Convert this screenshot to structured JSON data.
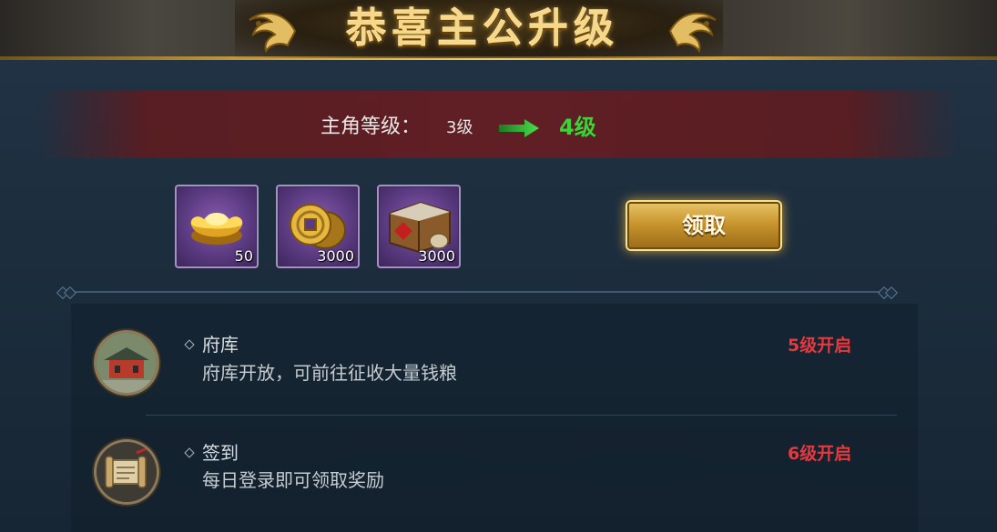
{
  "header": {
    "title": "恭喜主公升级",
    "left_ornament": "dragon-ornament-icon",
    "right_ornament": "dragon-ornament-icon"
  },
  "level": {
    "label": "主角等级：",
    "from": "3级",
    "to": "4级",
    "arrow_color": "#35d636"
  },
  "rewards": [
    {
      "icon": "gold-ingot-icon",
      "quantity": "50"
    },
    {
      "icon": "copper-coins-icon",
      "quantity": "3000"
    },
    {
      "icon": "grain-crate-icon",
      "quantity": "3000"
    }
  ],
  "claim_button": {
    "label": "领取"
  },
  "features": [
    {
      "icon": "treasury-building-icon",
      "name": "府库",
      "description": "府库开放，可前往征收大量钱粮",
      "unlock": "5级开启"
    },
    {
      "icon": "sign-in-scroll-icon",
      "name": "签到",
      "description": "每日登录即可领取奖励",
      "unlock": "6级开启"
    }
  ],
  "colors": {
    "accent_gold": "#f6d88a",
    "unlock_red": "#e8383c",
    "level_green": "#35d636",
    "reward_purple": "#5a3a80"
  }
}
